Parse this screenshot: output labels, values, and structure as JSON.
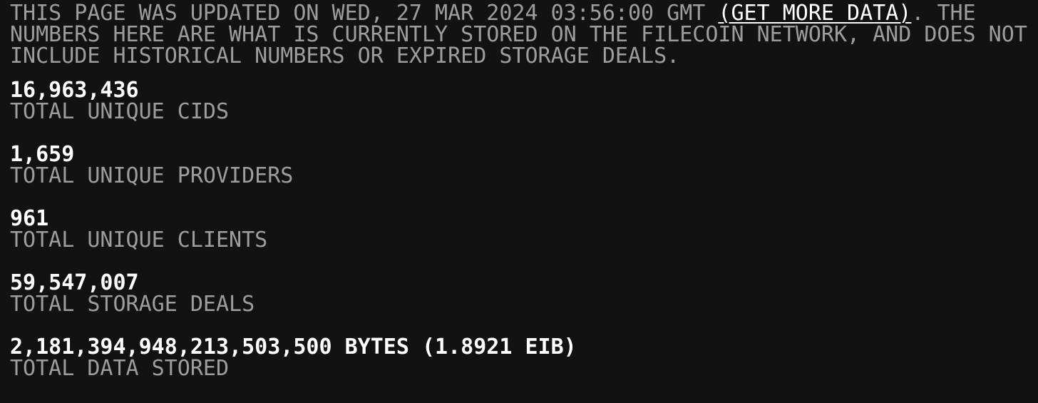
{
  "page": {
    "background_color": "#121212",
    "text_color": "#9d9d9d",
    "value_color": "#ffffff"
  },
  "notice": {
    "text_before_link": "THIS PAGE WAS UPDATED ON WED, 27 MAR 2024 03:56:00 GMT ",
    "link_label": "(GET MORE DATA)",
    "text_after_link": ". THE NUMBERS HERE ARE WHAT IS CURRENTLY STORED ON THE FILECOIN NETWORK, AND DOES NOT INCLUDE HISTORICAL NUMBERS OR EXPIRED STORAGE DEALS.",
    "updated_on": "WED, 27 MAR 2024 03:56:00 GMT"
  },
  "stats": [
    {
      "value": "16,963,436",
      "label": "TOTAL UNIQUE CIDS"
    },
    {
      "value": "1,659",
      "label": "TOTAL UNIQUE PROVIDERS"
    },
    {
      "value": "961",
      "label": "TOTAL UNIQUE CLIENTS"
    },
    {
      "value": "59,547,007",
      "label": "TOTAL STORAGE DEALS"
    },
    {
      "value": "2,181,394,948,213,503,500 BYTES (1.8921 EIB)",
      "label": "TOTAL DATA STORED"
    }
  ]
}
